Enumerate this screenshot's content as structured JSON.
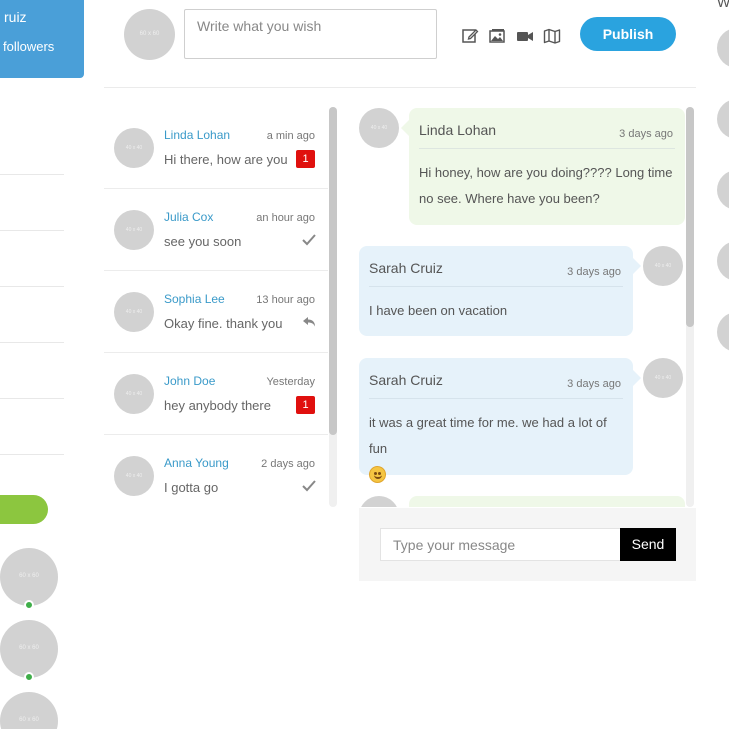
{
  "profile": {
    "name_fragment": "ruiz",
    "followers_label": "followers"
  },
  "composer": {
    "avatar_text": "60 x 60",
    "placeholder": "Write what you wish",
    "tools": [
      "edit-icon",
      "image-icon",
      "video-icon",
      "map-icon"
    ],
    "publish_label": "Publish"
  },
  "conversations": [
    {
      "name": "Linda Lohan",
      "time": "a min ago",
      "preview": "Hi there, how are you",
      "unread": "1",
      "status": null
    },
    {
      "name": "Julia Cox",
      "time": "an hour ago",
      "preview": "see you soon",
      "unread": null,
      "status": "check-icon"
    },
    {
      "name": "Sophia Lee",
      "time": "13 hour ago",
      "preview": "Okay fine. thank you",
      "unread": null,
      "status": "reply-icon"
    },
    {
      "name": "John Doe",
      "time": "Yesterday",
      "preview": "hey anybody there",
      "unread": "1",
      "status": null
    },
    {
      "name": "Anna Young",
      "time": "2 days ago",
      "preview": "I gotta go",
      "unread": null,
      "status": "check-icon"
    }
  ],
  "messages": [
    {
      "sender": "Linda Lohan",
      "time": "3 days ago",
      "text": "Hi honey, how are you doing???? Long time no see. Where have you been?",
      "direction": "in"
    },
    {
      "sender": "Sarah Cruiz",
      "time": "3 days ago",
      "text": "I have been on vacation",
      "direction": "out"
    },
    {
      "sender": "Sarah Cruiz",
      "time": "3 days ago",
      "text": "it was a great time for me. we had a lot of fun",
      "direction": "out",
      "emoji": "smile-emoji"
    }
  ],
  "message_input": {
    "placeholder": "Type your message",
    "send_label": "Send"
  },
  "avatar_placeholder": "40 x 40",
  "left_avatar_text": "60 x 60",
  "right_edge_letter": "W",
  "colors": {
    "accent": "#2aa3df",
    "profile_card": "#4a9fd8",
    "online": "#3fae49",
    "unread_badge": "#e0100e",
    "green_button": "#8cc63f",
    "incoming_bubble": "#eff8e8",
    "outgoing_bubble": "#e6f2fa"
  }
}
